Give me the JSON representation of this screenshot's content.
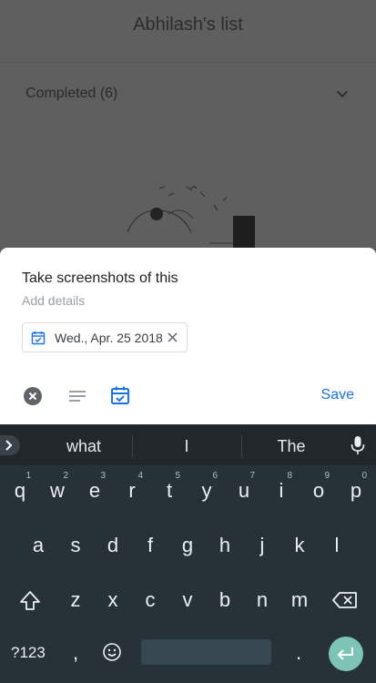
{
  "background_app": {
    "title": "Abhilash's list",
    "completed_label": "Completed (6)"
  },
  "sheet": {
    "task_title": "Take screenshots of this",
    "details_placeholder": "Add details",
    "date_chip": "Wed., Apr. 25 2018",
    "save_label": "Save",
    "accent_color": "#1a73e8"
  },
  "keyboard": {
    "suggestions": [
      "what",
      "I",
      "The"
    ],
    "row1": [
      {
        "key": "q",
        "num": "1"
      },
      {
        "key": "w",
        "num": "2"
      },
      {
        "key": "e",
        "num": "3"
      },
      {
        "key": "r",
        "num": "4"
      },
      {
        "key": "t",
        "num": "5"
      },
      {
        "key": "y",
        "num": "6"
      },
      {
        "key": "u",
        "num": "7"
      },
      {
        "key": "i",
        "num": "8"
      },
      {
        "key": "o",
        "num": "9"
      },
      {
        "key": "p",
        "num": "0"
      }
    ],
    "row2": [
      "a",
      "s",
      "d",
      "f",
      "g",
      "h",
      "j",
      "k",
      "l"
    ],
    "row3": [
      "z",
      "x",
      "c",
      "v",
      "b",
      "n",
      "m"
    ],
    "symbols_label": "?123",
    "comma": ",",
    "period": ".",
    "enter_color": "#7dc4b6"
  }
}
